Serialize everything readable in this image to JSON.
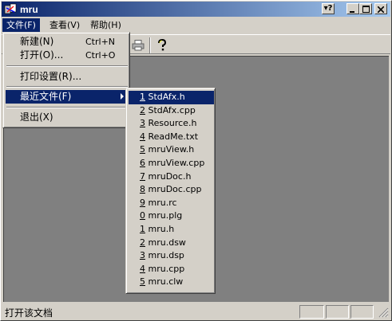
{
  "window": {
    "title": "mru",
    "caption_buttons": [
      "help",
      "minimize",
      "maximize",
      "close"
    ]
  },
  "menubar": {
    "items": [
      {
        "label": "文件(F)",
        "mnemonic": "F"
      },
      {
        "label": "查看(V)",
        "mnemonic": "V"
      },
      {
        "label": "帮助(H)",
        "mnemonic": "H"
      }
    ]
  },
  "toolbar": {
    "icons": [
      "print-icon",
      "help-icon"
    ]
  },
  "file_menu": {
    "items": [
      {
        "label": "新建(N)",
        "shortcut": "Ctrl+N"
      },
      {
        "label": "打开(O)...",
        "shortcut": "Ctrl+O"
      },
      {
        "label": "打印设置(R)..."
      },
      {
        "label": "最近文件(F)",
        "submenu": true,
        "highlighted": true
      },
      {
        "label": "退出(X)"
      }
    ]
  },
  "recent_menu": {
    "items": [
      {
        "num": "1",
        "name": "StdAfx.h"
      },
      {
        "num": "2",
        "name": "StdAfx.cpp"
      },
      {
        "num": "3",
        "name": "Resource.h"
      },
      {
        "num": "4",
        "name": "ReadMe.txt"
      },
      {
        "num": "5",
        "name": "mruView.h"
      },
      {
        "num": "6",
        "name": "mruView.cpp"
      },
      {
        "num": "7",
        "name": "mruDoc.h"
      },
      {
        "num": "8",
        "name": "mruDoc.cpp"
      },
      {
        "num": "9",
        "name": "mru.rc"
      },
      {
        "num": "0",
        "name": "mru.plg"
      },
      {
        "num": "1",
        "name": "mru.h"
      },
      {
        "num": "2",
        "name": "mru.dsw"
      },
      {
        "num": "3",
        "name": "mru.dsp"
      },
      {
        "num": "4",
        "name": "mru.cpp"
      },
      {
        "num": "5",
        "name": "mru.clw"
      }
    ],
    "selected_index": 0
  },
  "statusbar": {
    "text": "打开该文档"
  },
  "colors": {
    "face": "#d4d0c8",
    "highlight": "#0a246a",
    "client": "#808080"
  }
}
